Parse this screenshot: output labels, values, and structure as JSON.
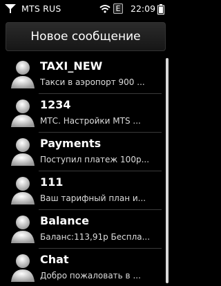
{
  "status_bar": {
    "carrier": "MTS RUS",
    "network_badge": "E",
    "time": "22:09",
    "icons": [
      "signal-icon",
      "wifi-icon",
      "battery-icon"
    ]
  },
  "header": {
    "title": "Новое сообщение"
  },
  "contacts": [
    {
      "name": "TAXI_NEW",
      "preview": "Такси в аэропорт 900 ..."
    },
    {
      "name": "1234",
      "preview": "МТС. Настройки MTS ..."
    },
    {
      "name": "Payments",
      "preview": "Поступил платеж 100р..."
    },
    {
      "name": "111",
      "preview": "Ваш тарифный план и..."
    },
    {
      "name": "Balance",
      "preview": "Баланс:113,91р Беспла..."
    },
    {
      "name": "Chat",
      "preview": "Добро пожаловать в ..."
    }
  ],
  "colors": {
    "background": "#000000",
    "text": "#ffffff",
    "scrollbar": "#d8d8d8"
  }
}
